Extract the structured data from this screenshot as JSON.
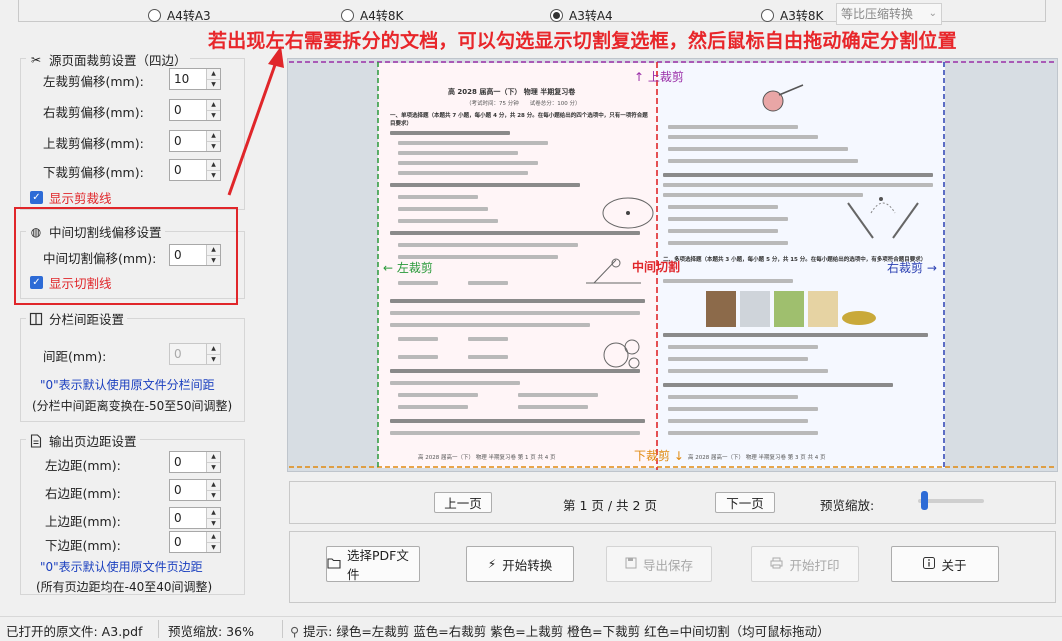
{
  "top_options": [
    {
      "label": "A4转A3",
      "checked": false
    },
    {
      "label": "A4转8K",
      "checked": false
    },
    {
      "label": "A3转A4",
      "checked": true
    },
    {
      "label": "A3转8K",
      "checked": false
    }
  ],
  "scale_select": "等比压缩转换",
  "annotation_text": "若出现左右需要拆分的文档，可以勾选显示切割复选框，然后鼠标自由拖动确定分割位置",
  "crop_group": {
    "title": "源页面裁剪设置（四边）",
    "fields": [
      {
        "label": "左裁剪偏移(mm):",
        "value": "10"
      },
      {
        "label": "右裁剪偏移(mm):",
        "value": "0"
      },
      {
        "label": "上裁剪偏移(mm):",
        "value": "0"
      },
      {
        "label": "下裁剪偏移(mm):",
        "value": "0"
      }
    ],
    "checkbox": "显示剪裁线"
  },
  "split_group": {
    "title": "中间切割线偏移设置",
    "field_label": "中间切割偏移(mm):",
    "field_value": "0",
    "checkbox": "显示切割线"
  },
  "column_group": {
    "title": "分栏间距设置",
    "field_label": "间距(mm):",
    "field_value": "0",
    "note1": "\"0\"表示默认使用原文件分栏间距",
    "note2": "(分栏中间距离变换在-50至50间调整)"
  },
  "margin_group": {
    "title": "输出页边距设置",
    "fields": [
      {
        "label": "左边距(mm):",
        "value": "0"
      },
      {
        "label": "右边距(mm):",
        "value": "0"
      },
      {
        "label": "上边距(mm):",
        "value": "0"
      },
      {
        "label": "下边距(mm):",
        "value": "0"
      }
    ],
    "note1": "\"0\"表示默认使用原文件页边距",
    "note2": "(所有页边距均在-40至40间调整)"
  },
  "preview_labels": {
    "top": "↑ 上裁剪",
    "bottom": "下裁剪 ↓",
    "left": "← 左裁剪",
    "right": "右裁剪 →",
    "middle": "中间切割"
  },
  "document": {
    "title": "高 2028 届高一（下） 物理 半期复习卷",
    "subtitle": "（考试时间：75 分钟　　试卷总分：100 分）",
    "section1": "一、单项选择题（本题共 7 小题，每小题 4 分，共 28 分。在每小题给出的四个选项中，只有一项符合题目要求）",
    "section2": "二、多项选择题（本题共 3 小题，每小题 5 分，共 15 分。在每小题给出的选项中，有多项符合题目要求）",
    "footer_left": "高 2028 届高一（下） 物理 半期复习卷 第 1 页 共 4 页",
    "footer_right": "高 2028 届高一（下） 物理 半期复习卷 第 3 页 共 4 页"
  },
  "pager": {
    "prev": "上一页",
    "page_info": "第 1 页 / 共 2 页",
    "next": "下一页",
    "zoom_label": "预览缩放:",
    "zoom_fraction": 0.05
  },
  "actions": [
    {
      "label": "选择PDF文件",
      "icon": "folder-icon",
      "enabled": true
    },
    {
      "label": "开始转换",
      "icon": "lightning-icon",
      "enabled": true
    },
    {
      "label": "导出保存",
      "icon": "save-icon",
      "enabled": false
    },
    {
      "label": "开始打印",
      "icon": "printer-icon",
      "enabled": false
    },
    {
      "label": "关于",
      "icon": "info-icon",
      "enabled": true
    }
  ],
  "status": {
    "file": "已打开的原文件: A3.pdf",
    "zoom": "预览缩放: 36%",
    "hint": "提示: 绿色=左裁剪 蓝色=右裁剪 紫色=上裁剪 橙色=下裁剪 红色=中间切割（均可鼠标拖动）"
  },
  "colors": {
    "left_crop": "#2a9a3a",
    "right_crop": "#2a3fb2",
    "top_crop": "#9a2ea8",
    "bottom_crop": "#e18a10",
    "middle_split": "#e0262a",
    "accent": "#2d6bd6"
  }
}
